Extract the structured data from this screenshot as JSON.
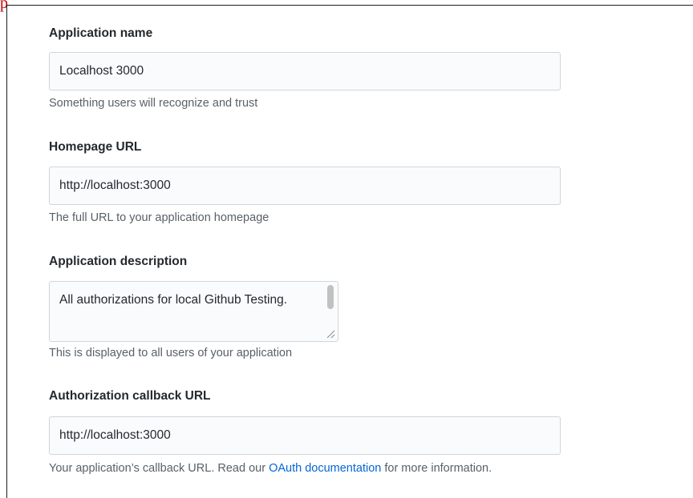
{
  "corner_mark": "p",
  "fields": {
    "app_name": {
      "label": "Application name",
      "value": "Localhost 3000",
      "hint": "Something users will recognize and trust"
    },
    "homepage_url": {
      "label": "Homepage URL",
      "value": "http://localhost:3000",
      "hint": "The full URL to your application homepage"
    },
    "description": {
      "label": "Application description",
      "value": "All authorizations for local Github Testing.",
      "hint": "This is displayed to all users of your application"
    },
    "callback_url": {
      "label": "Authorization callback URL",
      "value": "http://localhost:3000",
      "hint_before": "Your application’s callback URL. Read our ",
      "hint_link": "OAuth documentation",
      "hint_after": " for more information."
    }
  },
  "colors": {
    "link": "#0366d6",
    "hint": "#586069",
    "input_bg": "#fafbfc",
    "input_border": "#d1d5da"
  }
}
